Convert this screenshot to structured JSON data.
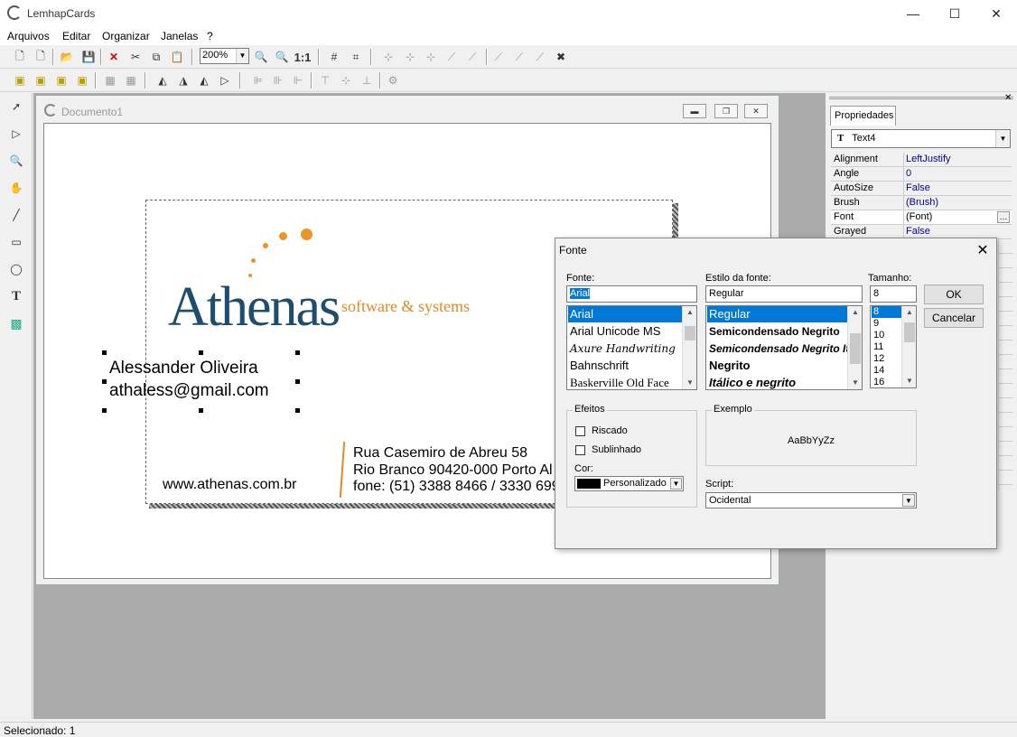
{
  "app": {
    "title": "LemhapCards"
  },
  "menu": [
    "Arquivos",
    "Editar",
    "Organizar",
    "Janelas",
    "?"
  ],
  "toolbar": {
    "zoom": "200%",
    "zoom_reset": "1:1"
  },
  "document": {
    "title": "Documento1"
  },
  "card": {
    "logo": "Athenas",
    "tagline": "software & systems",
    "name": "Alessander Oliveira",
    "email": "athaless@gmail.com",
    "website": "www.athenas.com.br",
    "address1": "Rua Casemiro de Abreu 58",
    "address2": "Rio Branco  90420-000  Porto Al",
    "address3": "fone: (51) 3388 8466 / 3330 699",
    "brand_color": "#1d4e6e",
    "accent_color": "#e08a25"
  },
  "properties": {
    "tab": "Propriedades",
    "selected_object": "Text4",
    "rows": [
      {
        "key": "Alignment",
        "value": "LeftJustify"
      },
      {
        "key": "Angle",
        "value": "0"
      },
      {
        "key": "AutoSize",
        "value": "False"
      },
      {
        "key": "Brush",
        "value": "(Brush)"
      },
      {
        "key": "Font",
        "value": "(Font)"
      },
      {
        "key": "Grayed",
        "value": "False"
      }
    ]
  },
  "status": {
    "text": "Selecionado: 1"
  },
  "font_dialog": {
    "title": "Fonte",
    "font_label": "Fonte:",
    "font_value": "Arial",
    "fonts": [
      "Arial",
      "Arial Unicode MS",
      "Axure Handwriting",
      "Bahnschrift",
      "Baskerville Old Face"
    ],
    "style_label": "Estilo da fonte:",
    "style_value": "Regular",
    "styles": [
      "Regular",
      "Semicondensado Negrito",
      "Semicondensado Negrito Itálic",
      "Negrito",
      "Itálico e negrito"
    ],
    "size_label": "Tamanho:",
    "size_value": "8",
    "sizes": [
      "8",
      "9",
      "10",
      "11",
      "12",
      "14",
      "16"
    ],
    "ok": "OK",
    "cancel": "Cancelar",
    "effects_label": "Efeitos",
    "strike_label": "Riscado",
    "underline_label": "Sublinhado",
    "color_label": "Cor:",
    "color_value": "Personalizado",
    "sample_label": "Exemplo",
    "sample_text": "AaBbYyZz",
    "script_label": "Script:",
    "script_value": "Ocidental",
    "highlight_color": "#0078d7"
  }
}
